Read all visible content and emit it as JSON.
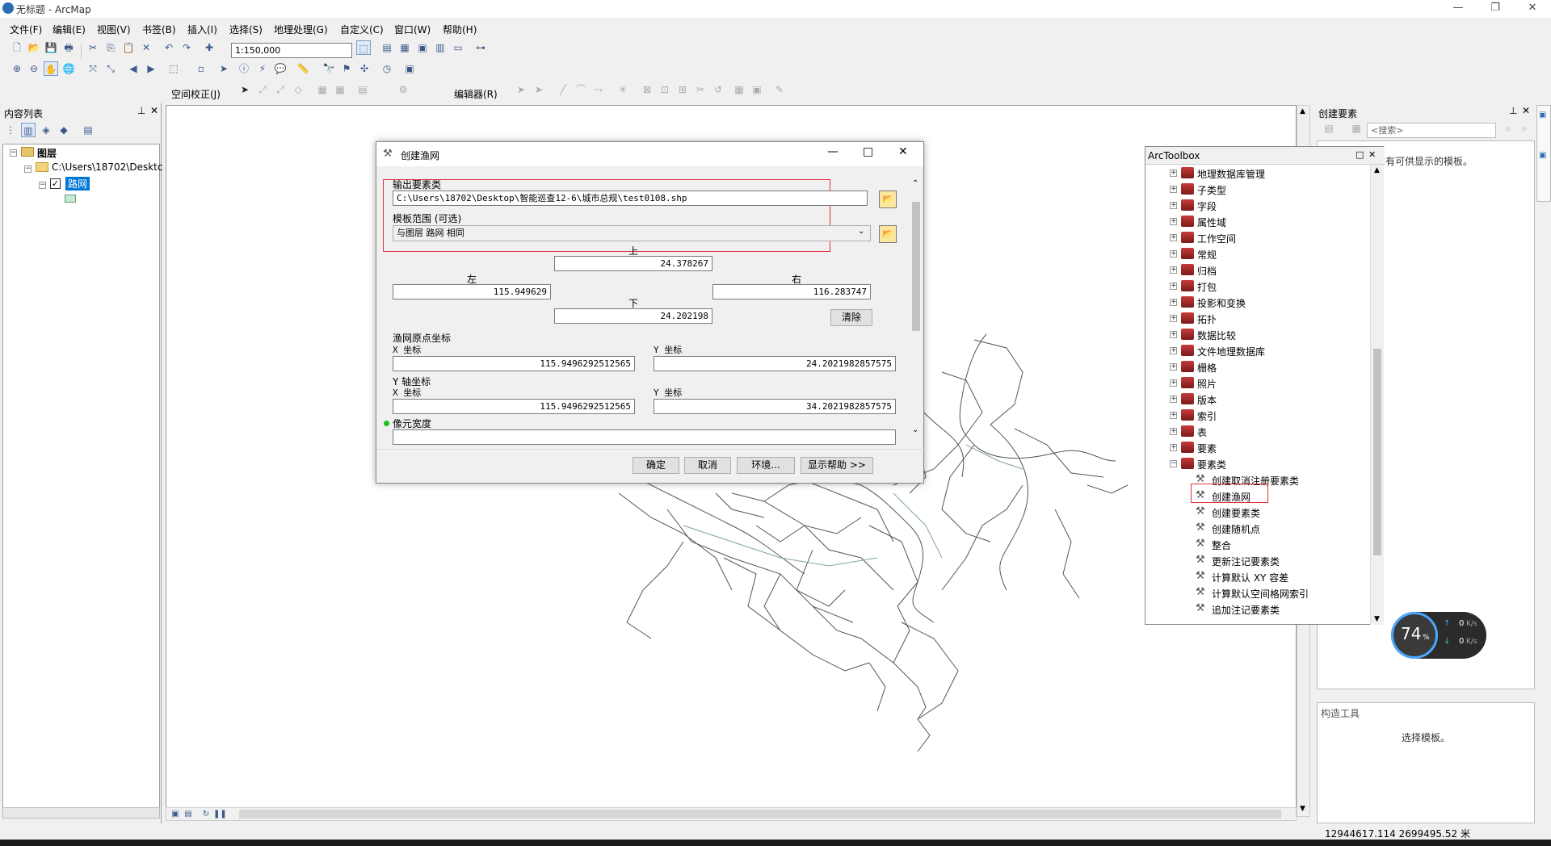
{
  "window": {
    "title": "无标题 - ArcMap",
    "minimize": "—",
    "restore": "❐",
    "close": "✕"
  },
  "menu": [
    "文件(F)",
    "编辑(E)",
    "视图(V)",
    "书签(B)",
    "插入(I)",
    "选择(S)",
    "地理处理(G)",
    "自定义(C)",
    "窗口(W)",
    "帮助(H)"
  ],
  "toolbar": {
    "scale": "1:150,000",
    "spatial_adjust": "空间校正(J)",
    "editor": "编辑器(R)"
  },
  "toc": {
    "title": "内容列表",
    "layers_root": "图层",
    "folder": "C:\\Users\\18702\\Desktc",
    "layer": "路网"
  },
  "dialog": {
    "title": "创建渔网",
    "output_label": "输出要素类",
    "output_value": "C:\\Users\\18702\\Desktop\\智能巡查12-6\\城市总规\\test0108.shp",
    "extent_label": "模板范围 (可选)",
    "extent_value": "与图层 路网 相同",
    "top_label": "上",
    "top_value": "24.378267",
    "left_label": "左",
    "left_value": "115.949629",
    "right_label": "右",
    "right_value": "116.283747",
    "bottom_label": "下",
    "bottom_value": "24.202198",
    "clear": "清除",
    "origin_label": "渔网原点坐标",
    "origin_x_label": "X 坐标",
    "origin_x": "115.9496292512565",
    "origin_y_label": "Y 坐标",
    "origin_y": "24.2021982857575",
    "yaxis_label": "Y 轴坐标",
    "yaxis_x_label": "X 坐标",
    "yaxis_x": "115.9496292512565",
    "yaxis_y_label": "Y 坐标",
    "yaxis_y": "34.2021982857575",
    "cell_width_label": "像元宽度",
    "cell_width_value": "",
    "ok": "确定",
    "cancel": "取消",
    "env": "环境...",
    "help": "显示帮助 >>"
  },
  "toolbox": {
    "title": "ArcToolbox",
    "items": [
      "地理数据库管理",
      "子类型",
      "字段",
      "属性域",
      "工作空间",
      "常规",
      "归档",
      "打包",
      "投影和变换",
      "拓扑",
      "数据比较",
      "文件地理数据库",
      "栅格",
      "照片",
      "版本",
      "索引",
      "表",
      "要素",
      "要素类"
    ],
    "tools": [
      "创建取消注册要素类",
      "创建渔网",
      "创建要素类",
      "创建随机点",
      "整合",
      "更新注记要素类",
      "计算默认 XY 容差",
      "计算默认空间格网索引",
      "追加注记要素类"
    ]
  },
  "create_features": {
    "title": "创建要素",
    "search_placeholder": "<搜索>",
    "empty_text": "有可供显示的模板。",
    "construct_title": "构造工具",
    "construct_text": "选择模板。"
  },
  "net_widget": {
    "percent": "74",
    "percent_unit": "%",
    "up": "0",
    "up_unit": "K/s",
    "down": "0",
    "down_unit": "K/s"
  },
  "status": {
    "coords": "12944617.114   2699495.52 米"
  },
  "colors": {
    "highlight": "#e0303a",
    "selection": "#0078d7"
  }
}
